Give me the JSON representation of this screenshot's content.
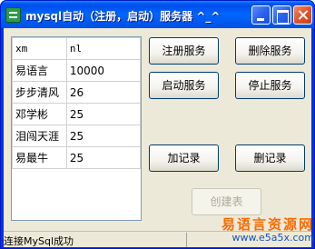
{
  "window": {
    "title": "mysql自动（注册，启动）服务器 ^_^"
  },
  "table": {
    "headers": [
      "xm",
      "nl"
    ],
    "rows": [
      [
        "易语言",
        "10000"
      ],
      [
        "步步清风",
        "26"
      ],
      [
        "邓学彬",
        "25"
      ],
      [
        "泪闯天涯",
        "25"
      ],
      [
        "易最牛",
        "25"
      ]
    ]
  },
  "buttons": {
    "register": "注册服务",
    "delete": "删除服务",
    "start": "启动服务",
    "stop": "停止服务",
    "add_record": "加记录",
    "delete_record": "删记录",
    "create_table": "创建表"
  },
  "statusbar": {
    "text": "连接MySql成功"
  },
  "watermark": {
    "brand": "易语言资源网",
    "url": "www.e5a5x.com"
  }
}
